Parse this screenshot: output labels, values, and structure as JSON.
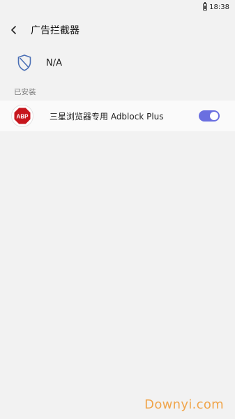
{
  "status_bar": {
    "time": "18:38",
    "battery_icon": "battery-icon"
  },
  "header": {
    "back_icon": "back-arrow-icon",
    "title": "广告拦截器"
  },
  "current_blocker": {
    "icon": "shield-icon",
    "value": "N/A"
  },
  "installed_section": {
    "label": "已安装"
  },
  "addons": [
    {
      "name": "三星浏览器专用 Adblock Plus",
      "icon": "abp-logo-icon",
      "icon_text": "ABP",
      "enabled": true
    }
  ],
  "colors": {
    "background": "#f2f2f2",
    "toggle_on": "#6a6fe0",
    "abp_red": "#c7161d",
    "watermark": "#f0a54b"
  },
  "watermark": {
    "text": "Downyi.com"
  }
}
